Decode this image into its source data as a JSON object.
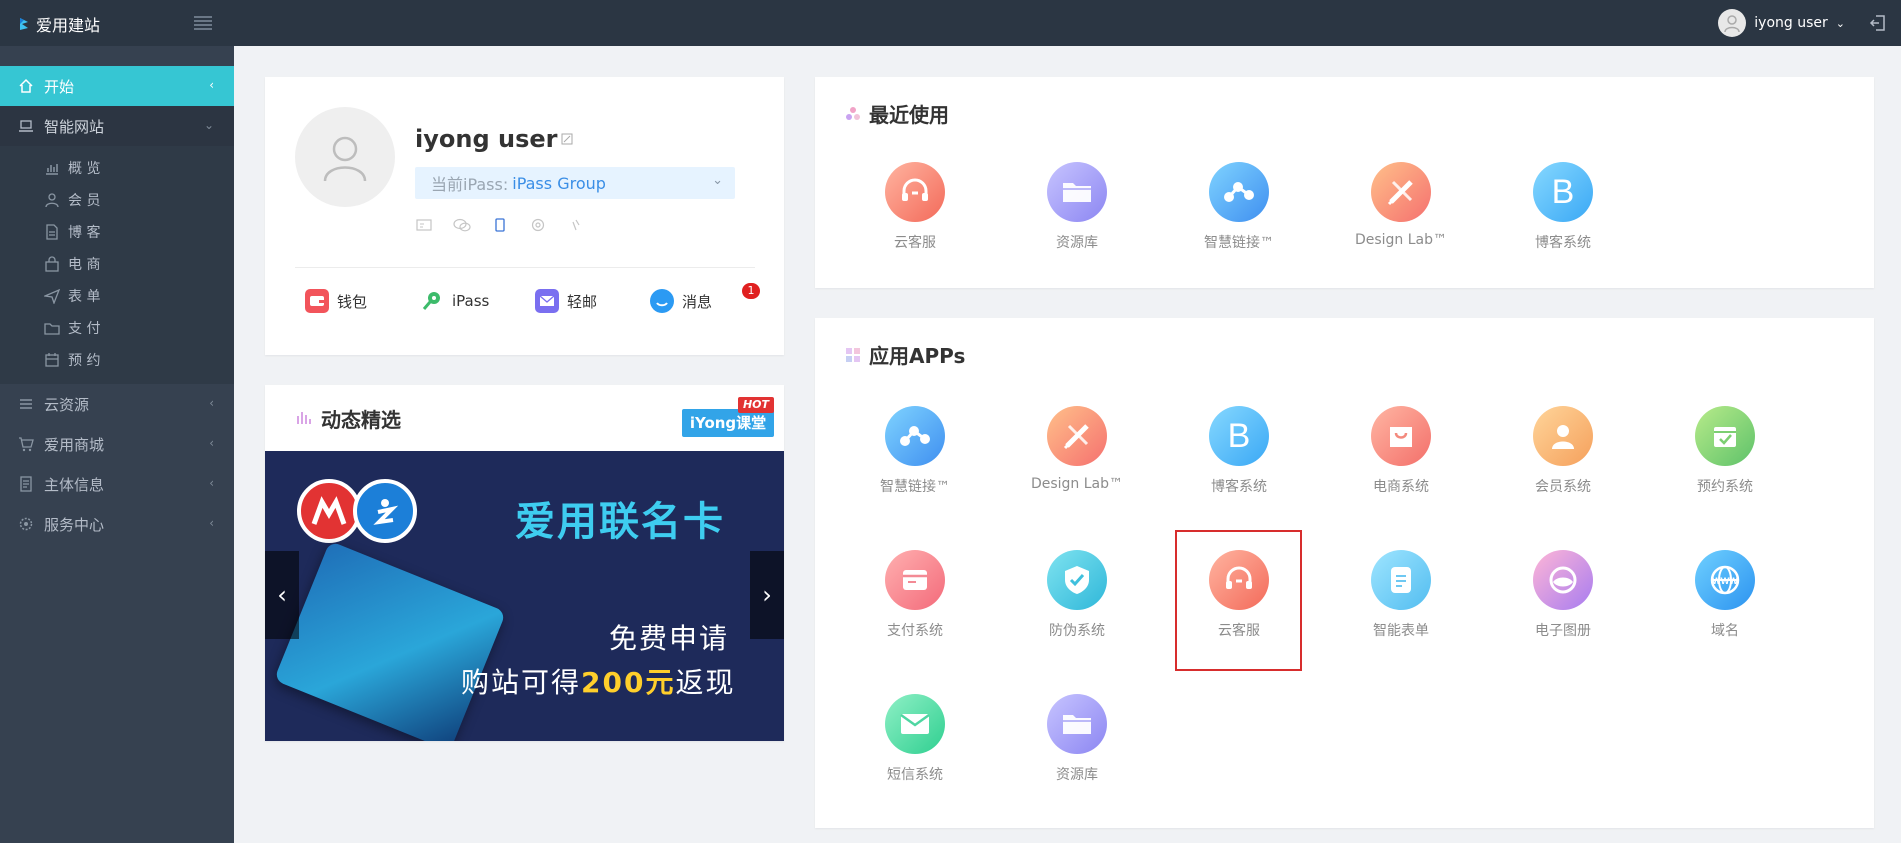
{
  "topbar": {
    "brand": "爱用建站",
    "username": "iyong user"
  },
  "sidebar": {
    "items": [
      {
        "label": "开始",
        "icon": "home-icon"
      },
      {
        "label": "智能网站",
        "icon": "laptop-icon"
      },
      {
        "label": "云资源",
        "icon": "list-icon"
      },
      {
        "label": "爱用商城",
        "icon": "cart-icon"
      },
      {
        "label": "主体信息",
        "icon": "document-icon"
      },
      {
        "label": "服务中心",
        "icon": "settings-icon"
      }
    ],
    "subitems": [
      {
        "label": "概 览",
        "icon": "chart-icon"
      },
      {
        "label": "会 员",
        "icon": "user-icon"
      },
      {
        "label": "博 客",
        "icon": "doc-icon"
      },
      {
        "label": "电 商",
        "icon": "bag-icon"
      },
      {
        "label": "表 单",
        "icon": "send-icon"
      },
      {
        "label": "支 付",
        "icon": "folder-icon"
      },
      {
        "label": "预 约",
        "icon": "calendar-icon"
      }
    ]
  },
  "profile": {
    "name": "iyong user",
    "ipass_prefix": "当前iPass:",
    "ipass_value": "iPass Group",
    "links": [
      {
        "label": "钱包",
        "icon": "wallet-icon",
        "color": "#f2545b"
      },
      {
        "label": "iPass",
        "icon": "key-icon",
        "color": "#3dbb6b"
      },
      {
        "label": "轻邮",
        "icon": "mail-icon",
        "color": "#7a6ff0"
      },
      {
        "label": "消息",
        "icon": "chat-icon",
        "color": "#2b9af3",
        "badge": "1"
      }
    ]
  },
  "news": {
    "title": "动态精选",
    "course_label": "iYong课堂",
    "hot_label": "HOT",
    "banner_title": "爱用联名卡",
    "banner_apply": "免费申请",
    "banner_cash_prefix": "购站可得",
    "banner_cash_amount": "200元",
    "banner_cash_suffix": "返现"
  },
  "recent": {
    "title": "最近使用",
    "tiles": [
      {
        "label": "云客服",
        "icon": "headset-icon",
        "colors": [
          "#ffb4a0",
          "#f36a5a"
        ]
      },
      {
        "label": "资源库",
        "icon": "folder-icon",
        "colors": [
          "#c7c4ff",
          "#8c86f2"
        ]
      },
      {
        "label": "智慧链接™",
        "icon": "share-icon",
        "colors": [
          "#7fd3ff",
          "#3f8ff0"
        ]
      },
      {
        "label": "Design Lab™",
        "icon": "design-icon",
        "colors": [
          "#ffc08a",
          "#f5706f"
        ]
      },
      {
        "label": "博客系统",
        "icon": "blog-icon",
        "colors": [
          "#86d8ff",
          "#3aa8f5"
        ]
      }
    ]
  },
  "apps": {
    "title": "应用APPs",
    "tiles": [
      {
        "label": "智慧链接™",
        "icon": "share-icon",
        "colors": [
          "#7fd3ff",
          "#3f8ff0"
        ]
      },
      {
        "label": "Design Lab™",
        "icon": "design-icon",
        "colors": [
          "#ffc08a",
          "#f5706f"
        ]
      },
      {
        "label": "博客系统",
        "icon": "blog-icon",
        "colors": [
          "#86d8ff",
          "#3aa8f5"
        ]
      },
      {
        "label": "电商系统",
        "icon": "shopping-bag-icon",
        "colors": [
          "#ffb6a3",
          "#f36f6a"
        ]
      },
      {
        "label": "会员系统",
        "icon": "member-icon",
        "colors": [
          "#ffd59a",
          "#f5a05c"
        ]
      },
      {
        "label": "预约系统",
        "icon": "calendar-check-icon",
        "colors": [
          "#b8eb8a",
          "#5ec26a"
        ]
      },
      {
        "label": "支付系统",
        "icon": "payment-icon",
        "colors": [
          "#ffb0b0",
          "#f36a7a"
        ]
      },
      {
        "label": "防伪系统",
        "icon": "shield-check-icon",
        "colors": [
          "#7fe3f0",
          "#2fb7d9"
        ]
      },
      {
        "label": "云客服",
        "icon": "headset-icon",
        "colors": [
          "#ffb4a0",
          "#f36a5a"
        ]
      },
      {
        "label": "智能表单",
        "icon": "form-icon",
        "colors": [
          "#9fe5ff",
          "#52bdf0"
        ]
      },
      {
        "label": "电子图册",
        "icon": "album-icon",
        "colors": [
          "#ffb6d6",
          "#a77cf0"
        ]
      },
      {
        "label": "域名",
        "icon": "globe-icon",
        "colors": [
          "#6fd0ff",
          "#2c93f0"
        ]
      },
      {
        "label": "短信系统",
        "icon": "sms-icon",
        "colors": [
          "#8ff0c6",
          "#2fcf90"
        ]
      },
      {
        "label": "资源库",
        "icon": "folder-icon",
        "colors": [
          "#c7c4ff",
          "#8c86f2"
        ]
      }
    ]
  }
}
